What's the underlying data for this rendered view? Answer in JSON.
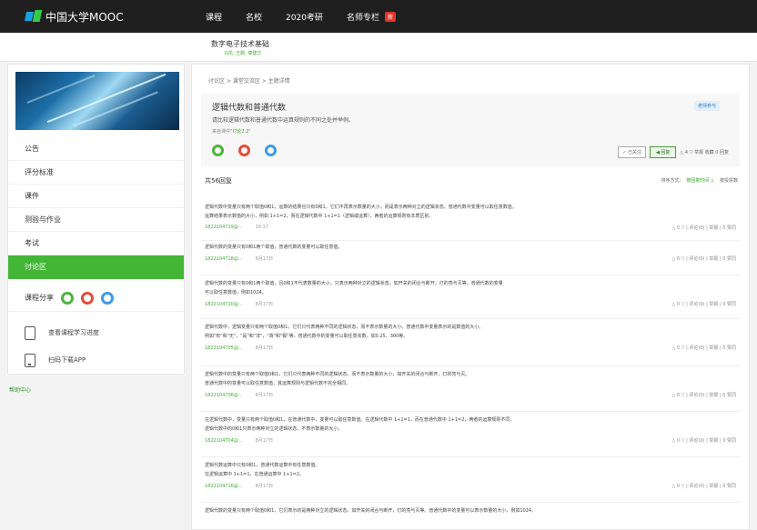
{
  "header": {
    "logo_text": "中国大学MOOC",
    "nav": [
      "课程",
      "名校",
      "2020考研",
      "名师专栏"
    ],
    "hot_badge": "新"
  },
  "course": {
    "title": "数字电子技术基础",
    "subtitle": "马凯, 王鹏, 康建华"
  },
  "sidebar": {
    "items": [
      "公告",
      "评分标准",
      "课件",
      "测验与作业",
      "考试",
      "讨论区"
    ],
    "active_index": 5,
    "share_label": "课程分享",
    "tools": [
      "查看课程学习进度",
      "扫码下载APP"
    ],
    "help_label": "帮助中心"
  },
  "breadcrumb": "讨论区  >  课堂交流区  >  主题详情",
  "post": {
    "title": "逻辑代数和普通代数",
    "tag": "老师参与",
    "body": "请比较逻辑代数和普通代数中运算规则的不同之处并举例。",
    "from_label": "来自课件",
    "from_link": "\"讨论2.2\"",
    "follow_label": "✓ 已关注",
    "reply_label": "◀ 回复",
    "stats": "△ 4 ▽   举报   收藏   0 回复"
  },
  "replies": {
    "title": "共56回复",
    "sort_label": "排序方式:",
    "sort_current": "按回复时间 ↓",
    "sort_other": "按投票数"
  },
  "reply_list": [
    {
      "lines": [
        "逻辑代数中变量只有两个取值0和1，运算的结果也只有0和1，它们不再表示数量的大小，而是表示两种对立的逻辑状态。普通代数中变量可以取任意数值，",
        "运算结果表示数值的大小，例如 1+1=2，而在逻辑代数中 1+1=1（逻辑或运算），两者的运算规则有本质区别。"
      ],
      "author": "1822104719@...",
      "time": "10:37",
      "acts": "△ 0 ▽  |  评论(0)  |  举报  |  0 赞同"
    },
    {
      "lines": [
        "逻辑代数的变量只有0和1两个取值，普通代数的变量可以取任意值。"
      ],
      "author": "1822104718@...",
      "time": "8月17日",
      "acts": "△ 0 ▽  |  评论(0)  |  举报  |  0 赞同"
    },
    {
      "lines": [
        "逻辑代数的变量只有0和1两个取值，且0和1不代表数量的大小，只表示两种对立的逻辑状态，如开关的闭合与断开，灯的亮与灭等。普通代数的变量",
        "可以取任意数值，例如1024。"
      ],
      "author": "1822104720@...",
      "time": "8月17日",
      "acts": "△ 0 ▽  |  评论(0)  |  举报  |  0 赞同"
    },
    {
      "lines": [
        "逻辑代数中，逻辑变量只有两个取值0和1，它们只代表两种不同的逻辑状态，而不表示数量的大小。普通代数中变量表示的是数值的大小。",
        "例如\"有\"和\"无\"，\"是\"和\"非\"，\"真\"和\"假\"等，普通代数中的变量可以取任意实数，如0.25、300等。"
      ],
      "author": "1822104705@...",
      "time": "8月17日",
      "acts": "△ 0 ▽  |  评论(0)  |  举报  |  0 赞同"
    },
    {
      "lines": [
        "逻辑代数中的变量只有两个取值0和1，它们只代表两种不同的逻辑状态，而不表示数量的大小，如开关的闭合与断开，灯的亮与灭。",
        "普通代数中的变量可以取任意数值，其运算规则与逻辑代数不完全相同。"
      ],
      "author": "1822104706@...",
      "time": "8月17日",
      "acts": "△ 0 ▽  |  评论(0)  |  举报  |  0 赞同"
    },
    {
      "lines": [
        "在逻辑代数中，变量只有两个取值0和1，在普通代数中，变量可以取任意数值。在逻辑代数中 1+1=1，而在普通代数中 1+1=2，两者的运算规则不同，",
        "逻辑代数中的0和1只表示两种对立的逻辑状态，不表示数量的大小。"
      ],
      "author": "1822104704@...",
      "time": "8月17日",
      "acts": "△ 0 ▽  |  评论(0)  |  举报  |  0 赞同"
    },
    {
      "lines": [
        "逻辑代数运算中只有0和1，普通代数运算中有任意数值。",
        "在逻辑运算中 1+1=1，在普通运算中 1+1=2。"
      ],
      "author": "1822104716@...",
      "time": "8月17日",
      "acts": "△ 0 ▽  |  评论(0)  |  举报  |  0 赞同"
    },
    {
      "lines": [
        "逻辑代数的变量只有两个取值0和1，它们表示的是两种对立的逻辑状态，如开关的闭合与断开，灯的亮与灭等。普通代数中的变量可以表示数量的大小，例如1024。"
      ],
      "author": "",
      "time": "",
      "acts": ""
    }
  ]
}
